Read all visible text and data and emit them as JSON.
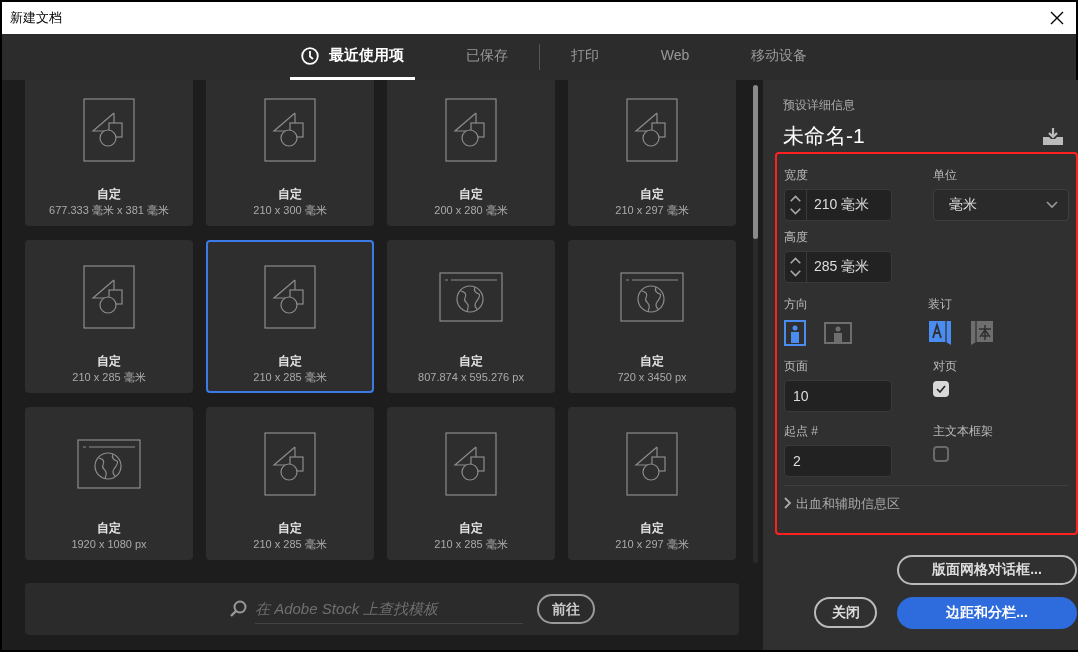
{
  "window": {
    "title": "新建文档"
  },
  "tabs": [
    {
      "label": "最近使用项",
      "kind": "recent",
      "selected": true
    },
    {
      "label": "已保存",
      "kind": "plain",
      "selected": false
    },
    {
      "label": "打印",
      "kind": "plain",
      "selected": false
    },
    {
      "label": "Web",
      "kind": "plain",
      "selected": false
    },
    {
      "label": "移动设备",
      "kind": "plain",
      "selected": false
    }
  ],
  "presets": [
    {
      "kind": "print",
      "name": "自定",
      "size": "677.333 毫米 x 381 毫米",
      "selected": false
    },
    {
      "kind": "print",
      "name": "自定",
      "size": "210 x 300 毫米",
      "selected": false
    },
    {
      "kind": "print",
      "name": "自定",
      "size": "200 x 280 毫米",
      "selected": false
    },
    {
      "kind": "print",
      "name": "自定",
      "size": "210 x 297 毫米",
      "selected": false
    },
    {
      "kind": "print",
      "name": "自定",
      "size": "210 x 285 毫米",
      "selected": false
    },
    {
      "kind": "print",
      "name": "自定",
      "size": "210 x 285 毫米",
      "selected": true
    },
    {
      "kind": "web",
      "name": "自定",
      "size": "807.874 x 595.276 px",
      "selected": false
    },
    {
      "kind": "web",
      "name": "自定",
      "size": "720 x 3450 px",
      "selected": false
    },
    {
      "kind": "web",
      "name": "自定",
      "size": "1920 x 1080 px",
      "selected": false
    },
    {
      "kind": "print",
      "name": "自定",
      "size": "210 x 285 毫米",
      "selected": false
    },
    {
      "kind": "print",
      "name": "自定",
      "size": "210 x 285 毫米",
      "selected": false
    },
    {
      "kind": "print",
      "name": "自定",
      "size": "210 x 297 毫米",
      "selected": false
    }
  ],
  "search": {
    "placeholder": "在 Adobe Stock 上查找模板",
    "button": "前往"
  },
  "details": {
    "heading": "预设详细信息",
    "name": "未命名-1",
    "width": {
      "label": "宽度",
      "value": "210 毫米"
    },
    "unit": {
      "label": "单位",
      "value": "毫米"
    },
    "height": {
      "label": "高度",
      "value": "285 毫米"
    },
    "orientation": {
      "label": "方向",
      "options": [
        {
          "kind": "portrait",
          "selected": true
        },
        {
          "kind": "landscape",
          "selected": false
        }
      ]
    },
    "binding": {
      "label": "装订",
      "options": [
        {
          "kind": "left_to_right",
          "selected": true
        },
        {
          "kind": "right_to_left",
          "selected": false
        }
      ]
    },
    "pages": {
      "label": "页面",
      "value": "10"
    },
    "facing_pages": {
      "label": "对页",
      "checked": true
    },
    "start_page": {
      "label": "起点 #",
      "value": "2"
    },
    "primary_text_frame": {
      "label": "主文本框架",
      "checked": false
    },
    "bleed_section": {
      "label": "出血和辅助信息区",
      "expanded": false
    }
  },
  "buttons": {
    "layout_grid": "版面网格对话框...",
    "close": "关闭",
    "margins": "边距和分栏..."
  }
}
